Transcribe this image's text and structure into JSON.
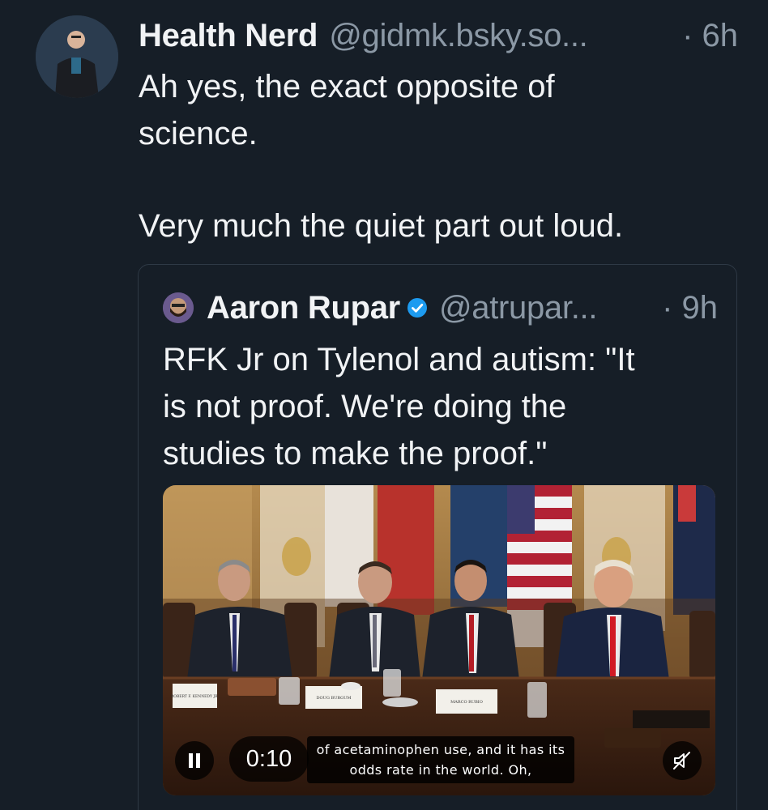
{
  "post": {
    "author_name": "Health Nerd",
    "author_handle": "@gidmk.bsky.so...",
    "time": "· 6h",
    "text_lines": [
      "Ah yes, the exact opposite of",
      "science."
    ],
    "text_para2": "Very much the quiet part out loud.",
    "avatar": "profile-photo"
  },
  "quote": {
    "author_name": "Aaron Rupar",
    "verified": true,
    "verified_icon": "verified-check-icon",
    "author_handle": "@atrupar...",
    "time": "· 9h",
    "text_lines": [
      "RFK Jr on Tylenol and autism: \"It",
      "is not proof. We're doing the",
      "studies to make the proof.\""
    ],
    "video": {
      "timecode": "0:10",
      "caption_lines": [
        "of acetaminophen use, and it has its",
        "odds rate in the world. Oh,"
      ],
      "play_state_icon": "pause-icon",
      "sound_icon": "muted-speaker-icon",
      "name_placards": [
        "ROBERT F. KENNEDY JR.",
        "DOUG BURGUM",
        "MARCO RUBIO"
      ]
    }
  },
  "colors": {
    "background": "#161e27",
    "text": "#f1f3f5",
    "muted": "#8b98a5",
    "verified": "#1d9bf0",
    "border": "#2e3945"
  }
}
